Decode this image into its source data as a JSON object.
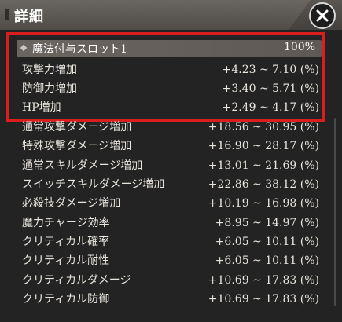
{
  "header": {
    "title": "詳細",
    "close_icon": "close-icon"
  },
  "section": {
    "name": "魔法付与スロット1",
    "percent": "100%"
  },
  "highlighted_rows": [
    {
      "label": "攻撃力増加",
      "value": "+4.23 ~ 7.10 (%)"
    },
    {
      "label": "防御力増加",
      "value": "+3.40 ~ 5.71 (%)"
    },
    {
      "label": "HP増加",
      "value": "+2.49 ~ 4.17 (%)"
    }
  ],
  "rows": [
    {
      "label": "通常攻撃ダメージ増加",
      "value": "+18.56 ~ 30.95 (%)"
    },
    {
      "label": "特殊攻撃ダメージ増加",
      "value": "+16.90 ~ 28.17 (%)"
    },
    {
      "label": "通常スキルダメージ増加",
      "value": "+13.01 ~ 21.69 (%)"
    },
    {
      "label": "スイッチスキルダメージ増加",
      "value": "+22.86 ~ 38.12 (%)"
    },
    {
      "label": "必殺技ダメージ増加",
      "value": "+10.19 ~ 16.98 (%)"
    },
    {
      "label": "魔力チャージ効率",
      "value": "+8.95 ~ 14.97 (%)"
    },
    {
      "label": "クリティカル確率",
      "value": "+6.05 ~ 10.11 (%)"
    },
    {
      "label": "クリティカル耐性",
      "value": "+6.05 ~ 10.11 (%)"
    },
    {
      "label": "クリティカルダメージ",
      "value": "+10.69 ~ 17.83 (%)"
    },
    {
      "label": "クリティカル防御",
      "value": "+10.69 ~ 17.83 (%)"
    }
  ],
  "colors": {
    "highlight_border": "#d81e1e",
    "panel_bg": "#232323"
  }
}
